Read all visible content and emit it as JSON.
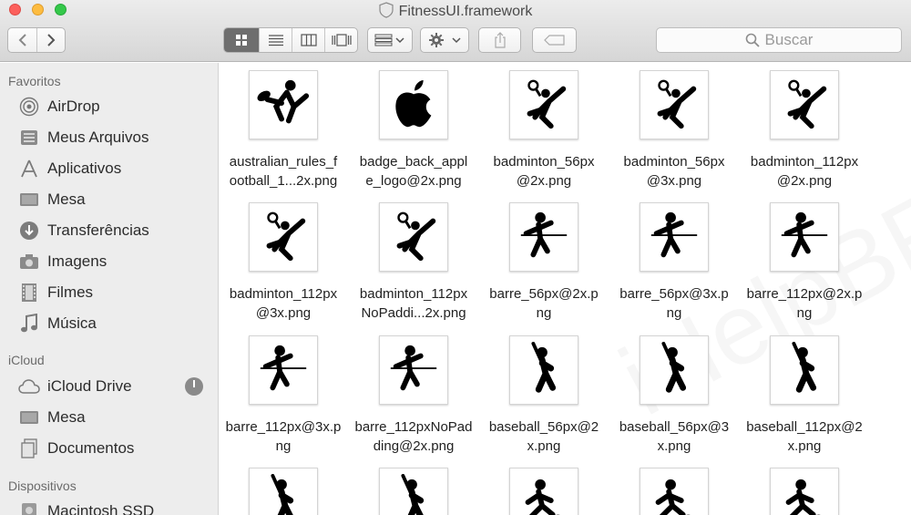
{
  "window": {
    "title": "FitnessUI.framework"
  },
  "toolbar": {
    "search_placeholder": "Buscar"
  },
  "sidebar": {
    "favorites_header": "Favoritos",
    "favorites": [
      {
        "label": "AirDrop",
        "icon": "airdrop-icon"
      },
      {
        "label": "Meus Arquivos",
        "icon": "all-files-icon"
      },
      {
        "label": "Aplicativos",
        "icon": "applications-icon"
      },
      {
        "label": "Mesa",
        "icon": "desktop-icon"
      },
      {
        "label": "Transferências",
        "icon": "downloads-icon"
      },
      {
        "label": "Imagens",
        "icon": "camera-icon"
      },
      {
        "label": "Filmes",
        "icon": "film-icon"
      },
      {
        "label": "Música",
        "icon": "music-note-icon"
      }
    ],
    "icloud_header": "iCloud",
    "icloud": [
      {
        "label": "iCloud Drive",
        "icon": "cloud-icon"
      },
      {
        "label": "Mesa",
        "icon": "desktop-icon"
      },
      {
        "label": "Documentos",
        "icon": "documents-icon"
      }
    ],
    "devices_header": "Dispositivos",
    "devices": [
      {
        "label": "Macintosh SSD",
        "icon": "disk-icon"
      }
    ]
  },
  "files": [
    {
      "line1": "australian_rules_f",
      "line2": "ootball_1...2x.png",
      "icon": "football-kick-icon"
    },
    {
      "line1": "badge_back_appl",
      "line2": "e_logo@2x.png",
      "icon": "apple-logo-icon"
    },
    {
      "line1": "badminton_56px",
      "line2": "@2x.png",
      "icon": "badminton-icon"
    },
    {
      "line1": "badminton_56px",
      "line2": "@3x.png",
      "icon": "badminton-icon"
    },
    {
      "line1": "badminton_112px",
      "line2": "@2x.png",
      "icon": "badminton-icon"
    },
    {
      "line1": "badminton_112px",
      "line2": "@3x.png",
      "icon": "badminton-icon"
    },
    {
      "line1": "badminton_112px",
      "line2": "NoPaddi...2x.png",
      "icon": "badminton-icon"
    },
    {
      "line1": "barre_56px@2x.p",
      "line2": "ng",
      "icon": "barre-icon"
    },
    {
      "line1": "barre_56px@3x.p",
      "line2": "ng",
      "icon": "barre-icon"
    },
    {
      "line1": "barre_112px@2x.p",
      "line2": "ng",
      "icon": "barre-icon"
    },
    {
      "line1": "barre_112px@3x.p",
      "line2": "ng",
      "icon": "barre-icon"
    },
    {
      "line1": "barre_112pxNoPad",
      "line2": "ding@2x.png",
      "icon": "barre-icon"
    },
    {
      "line1": "baseball_56px@2",
      "line2": "x.png",
      "icon": "baseball-icon"
    },
    {
      "line1": "baseball_56px@3",
      "line2": "x.png",
      "icon": "baseball-icon"
    },
    {
      "line1": "baseball_112px@2",
      "line2": "x.png",
      "icon": "baseball-icon"
    },
    {
      "line1": "",
      "line2": "",
      "icon": "baseball-icon"
    },
    {
      "line1": "",
      "line2": "",
      "icon": "baseball-icon"
    },
    {
      "line1": "",
      "line2": "",
      "icon": "basketball-icon"
    },
    {
      "line1": "",
      "line2": "",
      "icon": "basketball-icon"
    },
    {
      "line1": "",
      "line2": "",
      "icon": "basketball-icon"
    }
  ],
  "watermark": "iHelpBR.com"
}
